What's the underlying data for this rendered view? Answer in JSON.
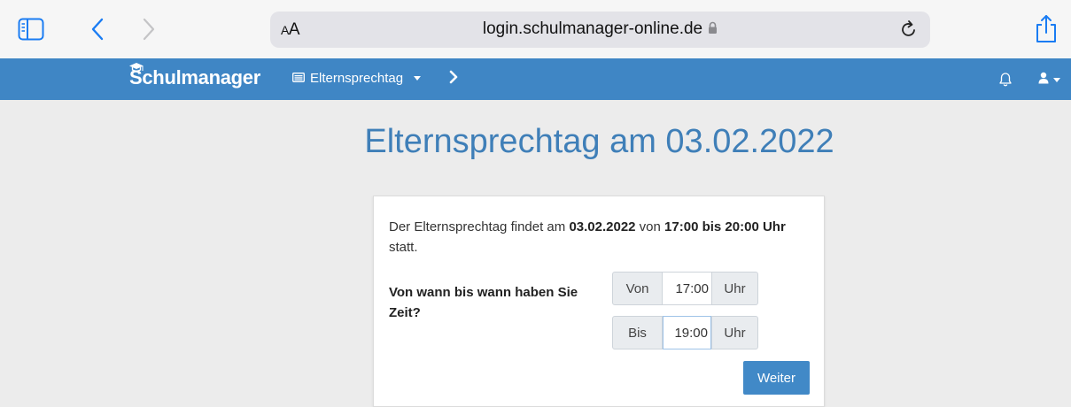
{
  "browser": {
    "aa_label_small": "A",
    "aa_label_large": "A",
    "url": "login.schulmanager-online.de",
    "icons": [
      "sidebar-icon",
      "back-icon",
      "forward-icon",
      "lock-icon",
      "reload-icon",
      "share-icon"
    ]
  },
  "navbar": {
    "brand": "Schulmanager",
    "menu_label": "Elternsprechtag",
    "icons": [
      "graduation-cap-icon",
      "calendar-list-icon",
      "chevron-right-icon",
      "bell-icon",
      "user-icon"
    ]
  },
  "main": {
    "title": "Elternsprechtag am 03.02.2022",
    "info_prefix": "Der Elternsprechtag findet am ",
    "info_date": "03.02.2022",
    "info_mid": " von ",
    "info_time": "17:00 bis 20:00 Uhr",
    "info_suffix": " statt.",
    "question": "Von wann bis wann haben Sie Zeit?",
    "from_label": "Von",
    "from_value": "17:00",
    "from_unit": "Uhr",
    "to_label": "Bis",
    "to_value": "19:00",
    "to_unit": "Uhr",
    "submit_label": "Weiter"
  },
  "colors": {
    "navbar_bg": "#3f86c5",
    "title": "#3f7fb8",
    "button": "#4189c7",
    "safari_accent": "#1a7cf3"
  }
}
